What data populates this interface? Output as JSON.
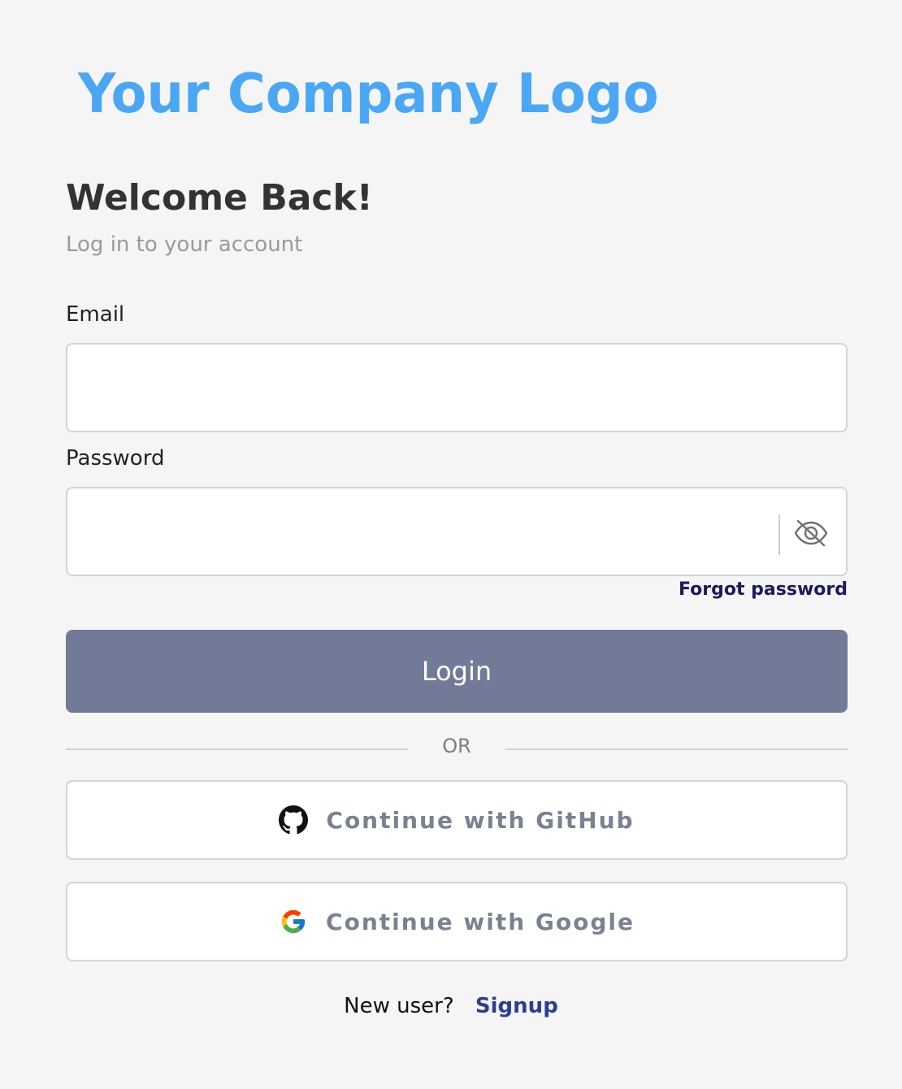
{
  "logo": {
    "text": "Your Company Logo",
    "color": "#4aa7f4"
  },
  "header": {
    "title": "Welcome Back!",
    "subtitle": "Log in to your account"
  },
  "form": {
    "email_label": "Email",
    "email_value": "",
    "email_placeholder": "",
    "password_label": "Password",
    "password_value": "",
    "password_placeholder": "",
    "password_toggle_icon": "eye-slash-icon",
    "forgot_password": "Forgot password",
    "login_label": "Login",
    "login_color": "#717b98"
  },
  "divider": {
    "text": "OR"
  },
  "oauth": {
    "github_label": "Continue with GitHub",
    "github_icon": "github-icon",
    "google_label": "Continue with Google",
    "google_icon": "google-icon"
  },
  "footer": {
    "prompt": "New user?",
    "signup_label": "Signup",
    "signup_color": "#2a3e94"
  }
}
